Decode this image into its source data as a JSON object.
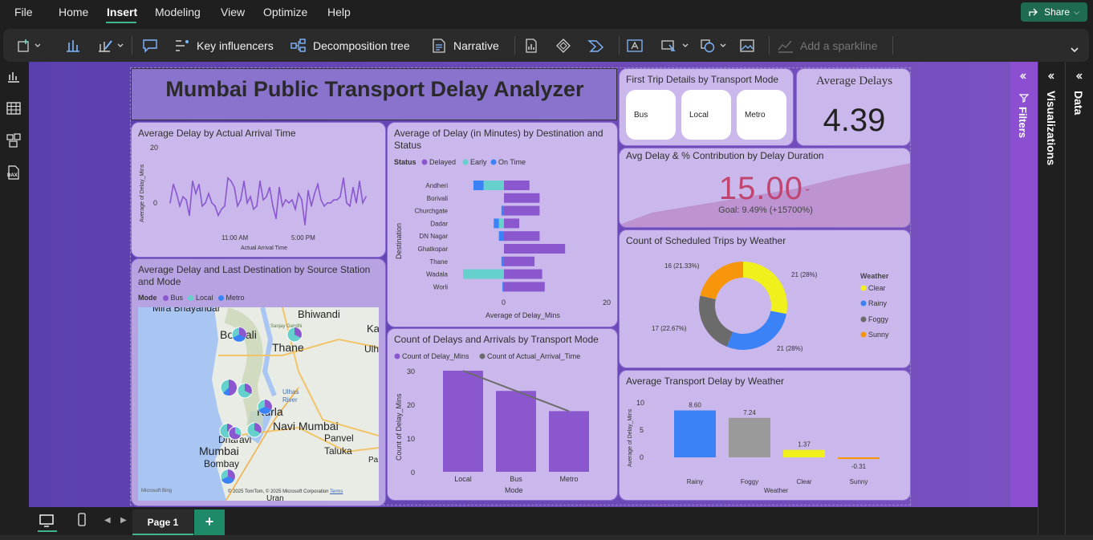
{
  "menu": {
    "items": [
      "File",
      "Home",
      "Insert",
      "Modeling",
      "View",
      "Optimize",
      "Help"
    ],
    "active": "Insert",
    "share_label": "Share"
  },
  "ribbon": {
    "key_influencers": "Key influencers",
    "decomposition_tree": "Decomposition tree",
    "narrative": "Narrative",
    "add_sparkline": "Add a sparkline"
  },
  "panes": {
    "filters": "Filters",
    "visualizations": "Visualizations",
    "data": "Data"
  },
  "pages": {
    "current": "Page 1",
    "add": "+"
  },
  "report": {
    "title": "Mumbai Public Transport Delay Analyzer",
    "first_trip": {
      "title": "First Trip Details by Transport Mode",
      "buttons": [
        "Bus",
        "Local",
        "Metro"
      ]
    },
    "kpi_avg": {
      "title": "Average Delays",
      "value": "4.39"
    },
    "kpi_duration": {
      "title": "Avg Delay & % Contribution by Delay Duration",
      "value": "15.00",
      "goal": "Goal: 9.49% (+15700%)"
    },
    "map": {
      "title": "Average Delay and Last Destination by Source Station and Mode",
      "legend_title": "Mode",
      "legend": [
        "Bus",
        "Local",
        "Metro"
      ],
      "places": [
        "Mira Bhayandar",
        "Bhiwandi",
        "Borivali",
        "Thane",
        "Kurla",
        "Navi Mumbai",
        "Dharavi",
        "Mumbai",
        "Bombay",
        "Panvel",
        "Taluka",
        "Ulhas",
        "River",
        "Sanjay Gandhi",
        "Ka",
        "Ulh",
        "Uran",
        "Pa"
      ],
      "attribution": "© 2025 TomTom, © 2025 Microsoft Corporation",
      "terms": "Terms",
      "bing": "Microsoft Bing"
    }
  },
  "chart_data": [
    {
      "id": "line",
      "type": "line",
      "title": "Average Delay by Actual Arrival Time",
      "xlabel": "Actual Arrival Time",
      "ylabel": "Average of Delay_Mins",
      "yticks": [
        "20",
        "0"
      ],
      "xticks": [
        "11:00 AM",
        "5:00 PM"
      ],
      "ylim": [
        -6,
        20
      ],
      "values": [
        2,
        8,
        5,
        1,
        4,
        3,
        -2,
        9,
        5,
        8,
        1,
        2,
        5,
        2,
        1,
        -2,
        0,
        1,
        10,
        9,
        7,
        1,
        3,
        9,
        2,
        4,
        0,
        1,
        9,
        3,
        4,
        7,
        1,
        -3,
        7,
        1,
        3,
        2,
        3,
        0,
        5,
        3,
        -5,
        6,
        1,
        5,
        8,
        3,
        1,
        2,
        2,
        3,
        3,
        4,
        10,
        2,
        1,
        7,
        2,
        9,
        2,
        4
      ]
    },
    {
      "id": "bar-dest",
      "type": "bar",
      "title": "Average of Delay (in Minutes) by Destination and Status",
      "legend_title": "Status",
      "xlabel": "Average of Delay_Mins",
      "ylabel": "Destination",
      "xticks": [
        "0",
        "20"
      ],
      "xlim": [
        -5,
        20
      ],
      "categories": [
        "Andheri",
        "Borivali",
        "Churchgate",
        "Dadar",
        "DN Nagar",
        "Ghatkopar",
        "Thane",
        "Wadala",
        "Worli"
      ],
      "series": [
        {
          "name": "Delayed",
          "color": "#8a57cf",
          "values": [
            5,
            7,
            7,
            3,
            7,
            12,
            6,
            7.5,
            8
          ]
        },
        {
          "name": "Early",
          "color": "#66d0cc",
          "values": [
            -4,
            0,
            0,
            -1,
            0,
            0,
            0,
            -8,
            0
          ]
        },
        {
          "name": "On Time",
          "color": "#3b82f6",
          "values": [
            -2,
            0,
            -0.5,
            -1,
            -1,
            0,
            -0.5,
            0,
            -0.3
          ]
        }
      ]
    },
    {
      "id": "combo",
      "type": "bar",
      "title": "Count of Delays and Arrivals by Transport Mode",
      "xlabel": "Mode",
      "ylabel": "Count of Delay_Mins",
      "yticks": [
        "30",
        "20",
        "10",
        "0"
      ],
      "ylim": [
        0,
        30
      ],
      "categories": [
        "Local",
        "Bus",
        "Metro"
      ],
      "series": [
        {
          "name": "Count of Delay_Mins",
          "color": "#8a57cf",
          "values": [
            30,
            24,
            18
          ]
        },
        {
          "name": "Count of Actual_Arrival_Time",
          "color": "#6b6b6b",
          "values": [
            30,
            24,
            18
          ]
        }
      ]
    },
    {
      "id": "donut",
      "type": "pie",
      "title": "Count of Scheduled Trips by Weather",
      "legend_title": "Weather",
      "categories": [
        "Clear",
        "Rainy",
        "Foggy",
        "Sunny"
      ],
      "values": [
        21,
        21,
        17,
        16
      ],
      "labels": [
        "21 (28%)",
        "21 (28%)",
        "17 (22.67%)",
        "16 (21.33%)"
      ],
      "colors": [
        "#f0f01c",
        "#3b82f6",
        "#6b6b6b",
        "#f7960b"
      ]
    },
    {
      "id": "bar-weather",
      "type": "bar",
      "title": "Average Transport Delay by Weather",
      "xlabel": "Weather",
      "ylabel": "Average of Delay_Mins",
      "yticks": [
        "10",
        "5",
        "0"
      ],
      "ylim": [
        0,
        10
      ],
      "categories": [
        "Rainy",
        "Foggy",
        "Clear",
        "Sunny"
      ],
      "values": [
        8.6,
        7.24,
        1.37,
        -0.31
      ],
      "labels": [
        "8.60",
        "7.24",
        "1.37",
        "-0.31"
      ],
      "colors": [
        "#3b82f6",
        "#9a9a9a",
        "#f0f01c",
        "#f7960b"
      ]
    }
  ]
}
